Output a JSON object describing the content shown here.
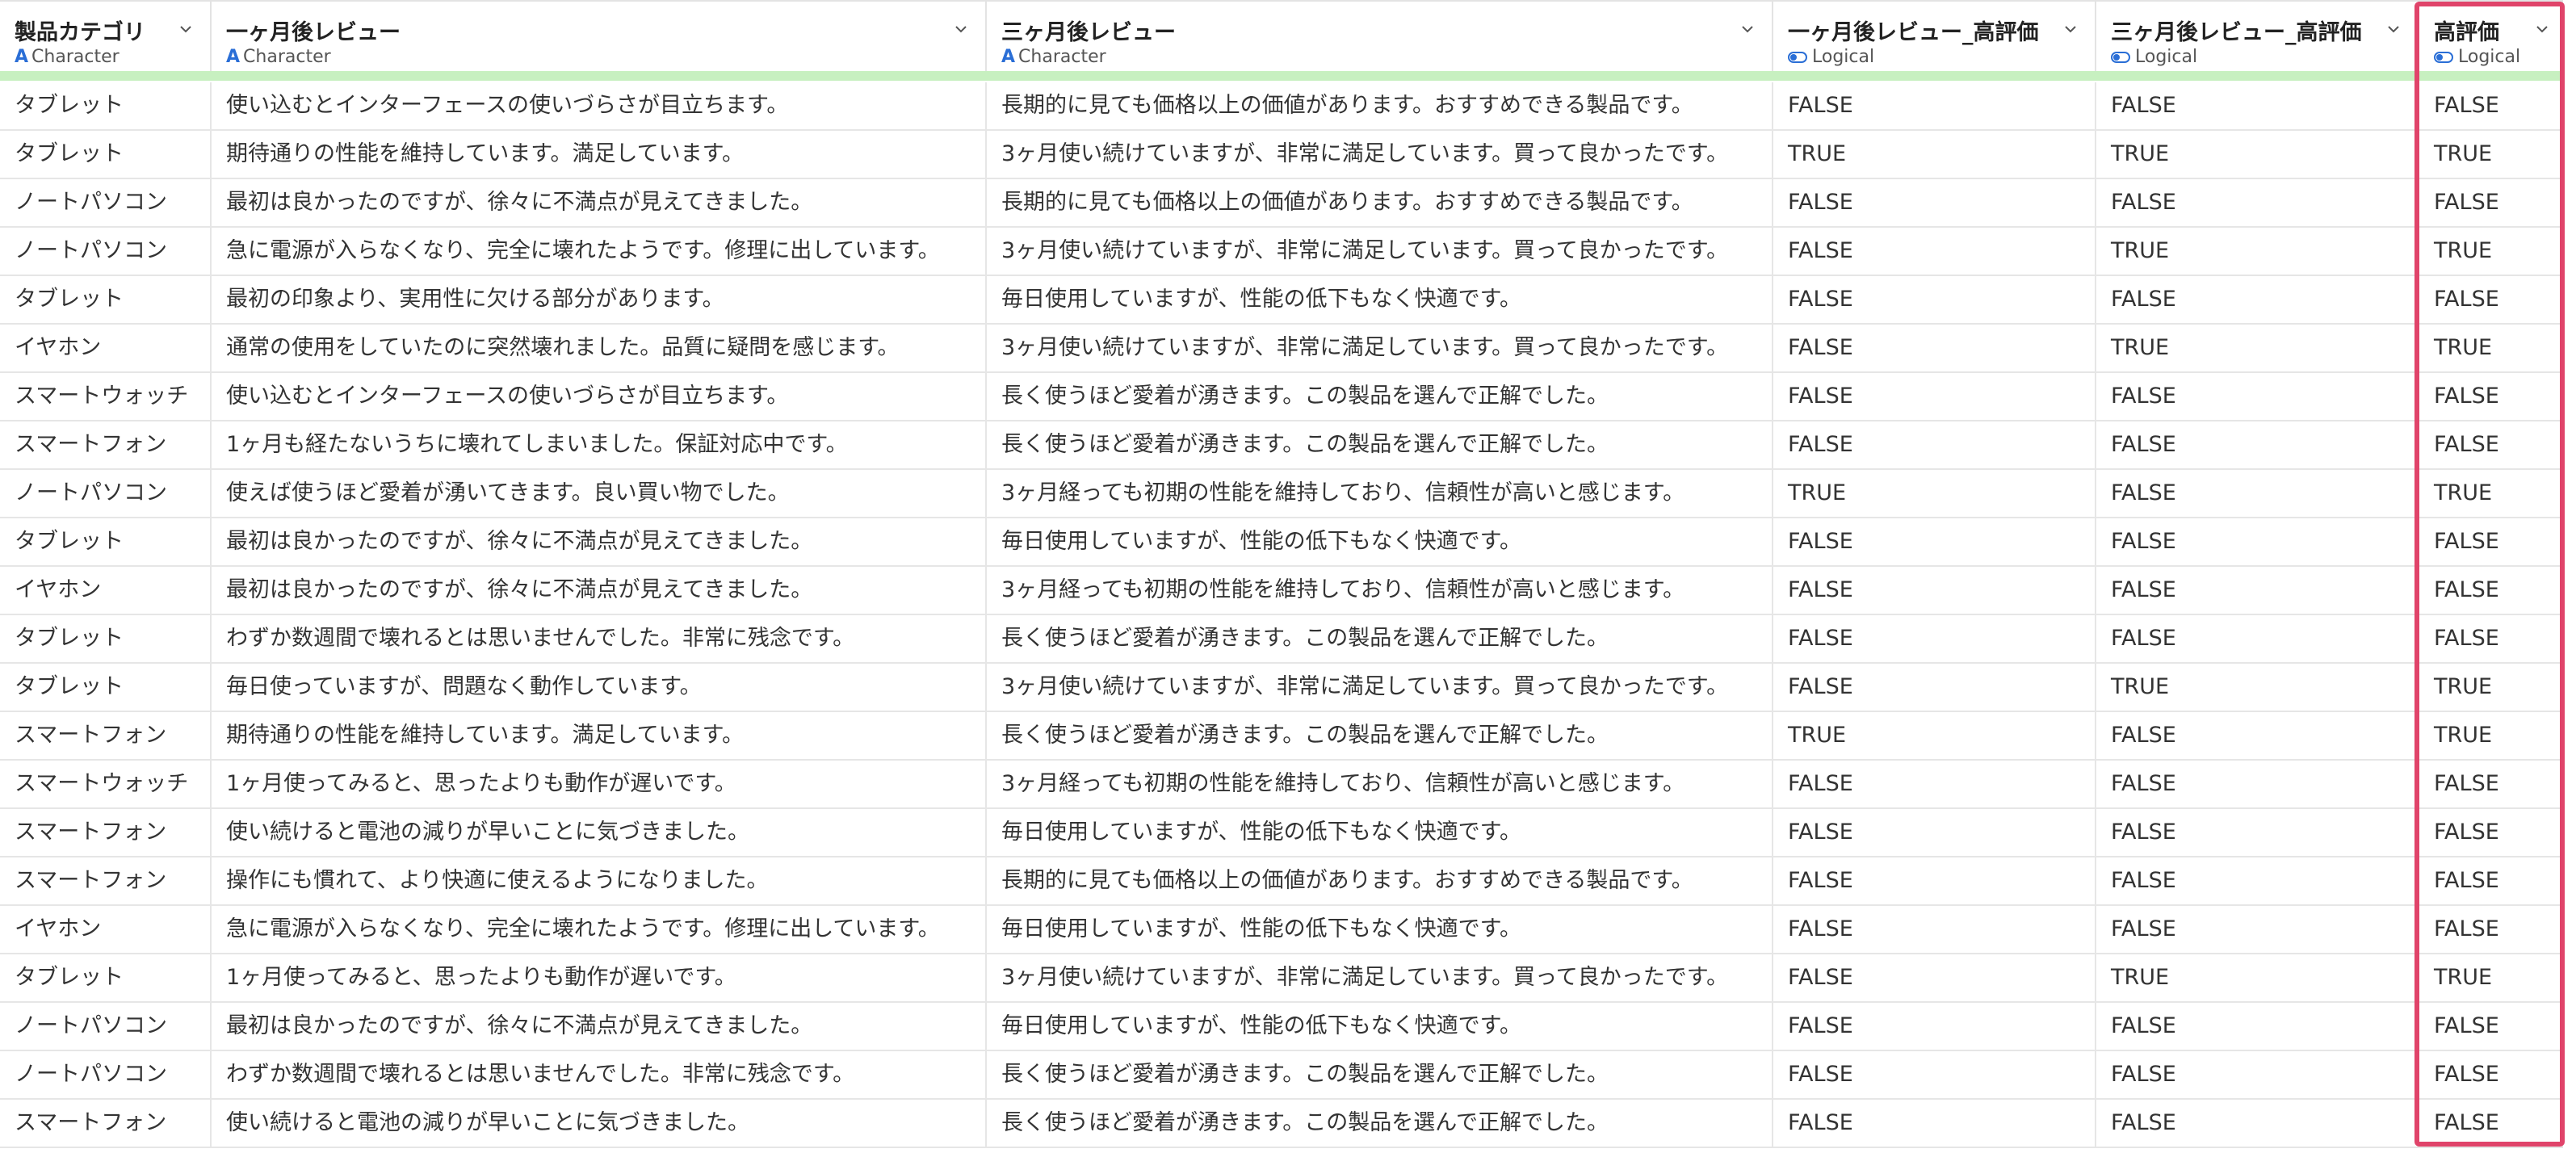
{
  "columns": [
    {
      "name": "製品カテゴリ",
      "type": "Character",
      "type_icon": "character-type-icon"
    },
    {
      "name": "一ヶ月後レビュー",
      "type": "Character",
      "type_icon": "character-type-icon"
    },
    {
      "name": "三ヶ月後レビュー",
      "type": "Character",
      "type_icon": "character-type-icon"
    },
    {
      "name": "一ヶ月後レビュー_高評価",
      "type": "Logical",
      "type_icon": "logical-type-icon"
    },
    {
      "name": "三ヶ月後レビュー_高評価",
      "type": "Logical",
      "type_icon": "logical-type-icon"
    },
    {
      "name": "高評価",
      "type": "Logical",
      "type_icon": "logical-type-icon"
    }
  ],
  "colors": {
    "highlight": "#e0446a",
    "header_bar": "#c7f0c0",
    "type_icon": "#2a6ed6"
  },
  "rows": [
    [
      "タブレット",
      "使い込むとインターフェースの使いづらさが目立ちます。",
      "長期的に見ても価格以上の価値があります。おすすめできる製品です。",
      "FALSE",
      "FALSE",
      "FALSE"
    ],
    [
      "タブレット",
      "期待通りの性能を維持しています。満足しています。",
      "3ヶ月使い続けていますが、非常に満足しています。買って良かったです。",
      "TRUE",
      "TRUE",
      "TRUE"
    ],
    [
      "ノートパソコン",
      "最初は良かったのですが、徐々に不満点が見えてきました。",
      "長期的に見ても価格以上の価値があります。おすすめできる製品です。",
      "FALSE",
      "FALSE",
      "FALSE"
    ],
    [
      "ノートパソコン",
      "急に電源が入らなくなり、完全に壊れたようです。修理に出しています。",
      "3ヶ月使い続けていますが、非常に満足しています。買って良かったです。",
      "FALSE",
      "TRUE",
      "TRUE"
    ],
    [
      "タブレット",
      "最初の印象より、実用性に欠ける部分があります。",
      "毎日使用していますが、性能の低下もなく快適です。",
      "FALSE",
      "FALSE",
      "FALSE"
    ],
    [
      "イヤホン",
      "通常の使用をしていたのに突然壊れました。品質に疑問を感じます。",
      "3ヶ月使い続けていますが、非常に満足しています。買って良かったです。",
      "FALSE",
      "TRUE",
      "TRUE"
    ],
    [
      "スマートウォッチ",
      "使い込むとインターフェースの使いづらさが目立ちます。",
      "長く使うほど愛着が湧きます。この製品を選んで正解でした。",
      "FALSE",
      "FALSE",
      "FALSE"
    ],
    [
      "スマートフォン",
      "1ヶ月も経たないうちに壊れてしまいました。保証対応中です。",
      "長く使うほど愛着が湧きます。この製品を選んで正解でした。",
      "FALSE",
      "FALSE",
      "FALSE"
    ],
    [
      "ノートパソコン",
      "使えば使うほど愛着が湧いてきます。良い買い物でした。",
      "3ヶ月経っても初期の性能を維持しており、信頼性が高いと感じます。",
      "TRUE",
      "FALSE",
      "TRUE"
    ],
    [
      "タブレット",
      "最初は良かったのですが、徐々に不満点が見えてきました。",
      "毎日使用していますが、性能の低下もなく快適です。",
      "FALSE",
      "FALSE",
      "FALSE"
    ],
    [
      "イヤホン",
      "最初は良かったのですが、徐々に不満点が見えてきました。",
      "3ヶ月経っても初期の性能を維持しており、信頼性が高いと感じます。",
      "FALSE",
      "FALSE",
      "FALSE"
    ],
    [
      "タブレット",
      "わずか数週間で壊れるとは思いませんでした。非常に残念です。",
      "長く使うほど愛着が湧きます。この製品を選んで正解でした。",
      "FALSE",
      "FALSE",
      "FALSE"
    ],
    [
      "タブレット",
      "毎日使っていますが、問題なく動作しています。",
      "3ヶ月使い続けていますが、非常に満足しています。買って良かったです。",
      "FALSE",
      "TRUE",
      "TRUE"
    ],
    [
      "スマートフォン",
      "期待通りの性能を維持しています。満足しています。",
      "長く使うほど愛着が湧きます。この製品を選んで正解でした。",
      "TRUE",
      "FALSE",
      "TRUE"
    ],
    [
      "スマートウォッチ",
      "1ヶ月使ってみると、思ったよりも動作が遅いです。",
      "3ヶ月経っても初期の性能を維持しており、信頼性が高いと感じます。",
      "FALSE",
      "FALSE",
      "FALSE"
    ],
    [
      "スマートフォン",
      "使い続けると電池の減りが早いことに気づきました。",
      "毎日使用していますが、性能の低下もなく快適です。",
      "FALSE",
      "FALSE",
      "FALSE"
    ],
    [
      "スマートフォン",
      "操作にも慣れて、より快適に使えるようになりました。",
      "長期的に見ても価格以上の価値があります。おすすめできる製品です。",
      "FALSE",
      "FALSE",
      "FALSE"
    ],
    [
      "イヤホン",
      "急に電源が入らなくなり、完全に壊れたようです。修理に出しています。",
      "毎日使用していますが、性能の低下もなく快適です。",
      "FALSE",
      "FALSE",
      "FALSE"
    ],
    [
      "タブレット",
      "1ヶ月使ってみると、思ったよりも動作が遅いです。",
      "3ヶ月使い続けていますが、非常に満足しています。買って良かったです。",
      "FALSE",
      "TRUE",
      "TRUE"
    ],
    [
      "ノートパソコン",
      "最初は良かったのですが、徐々に不満点が見えてきました。",
      "毎日使用していますが、性能の低下もなく快適です。",
      "FALSE",
      "FALSE",
      "FALSE"
    ],
    [
      "ノートパソコン",
      "わずか数週間で壊れるとは思いませんでした。非常に残念です。",
      "長く使うほど愛着が湧きます。この製品を選んで正解でした。",
      "FALSE",
      "FALSE",
      "FALSE"
    ],
    [
      "スマートフォン",
      "使い続けると電池の減りが早いことに気づきました。",
      "長く使うほど愛着が湧きます。この製品を選んで正解でした。",
      "FALSE",
      "FALSE",
      "FALSE"
    ]
  ]
}
